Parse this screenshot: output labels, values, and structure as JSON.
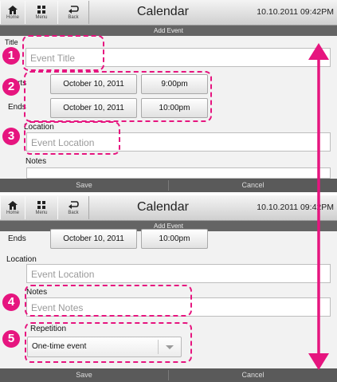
{
  "top_panel": {
    "toolbar": {
      "home_label": "Home",
      "menu_label": "Menu",
      "back_label": "Back"
    },
    "app_title": "Calendar",
    "datetime": "10.10.2011 09:42PM",
    "subtitle": "Add Event",
    "title_label": "Title",
    "title_placeholder": "Event Title",
    "starts_label": "Starts",
    "starts_date": "October 10, 2011",
    "starts_time": "9:00pm",
    "ends_label": "Ends",
    "ends_date": "October 10, 2011",
    "ends_time": "10:00pm",
    "location_label": "Location",
    "location_placeholder": "Event Location",
    "notes_label": "Notes",
    "save_label": "Save",
    "cancel_label": "Cancel"
  },
  "bottom_panel": {
    "toolbar": {
      "home_label": "Home",
      "menu_label": "Menu",
      "back_label": "Back"
    },
    "app_title": "Calendar",
    "datetime": "10.10.2011 09:42PM",
    "subtitle": "Add Event",
    "ends_label": "Ends",
    "ends_date": "October 10, 2011",
    "ends_time": "10:00pm",
    "location_label": "Location",
    "location_placeholder": "Event Location",
    "notes_label": "Notes",
    "notes_placeholder": "Event Notes",
    "repetition_label": "Repetition",
    "repetition_value": "One-time event",
    "save_label": "Save",
    "cancel_label": "Cancel"
  },
  "callouts": [
    "1",
    "2",
    "3",
    "4",
    "5"
  ],
  "colors": {
    "highlight": "#e6157f",
    "subbar": "#646464",
    "bottombar": "#5a5a5a"
  }
}
